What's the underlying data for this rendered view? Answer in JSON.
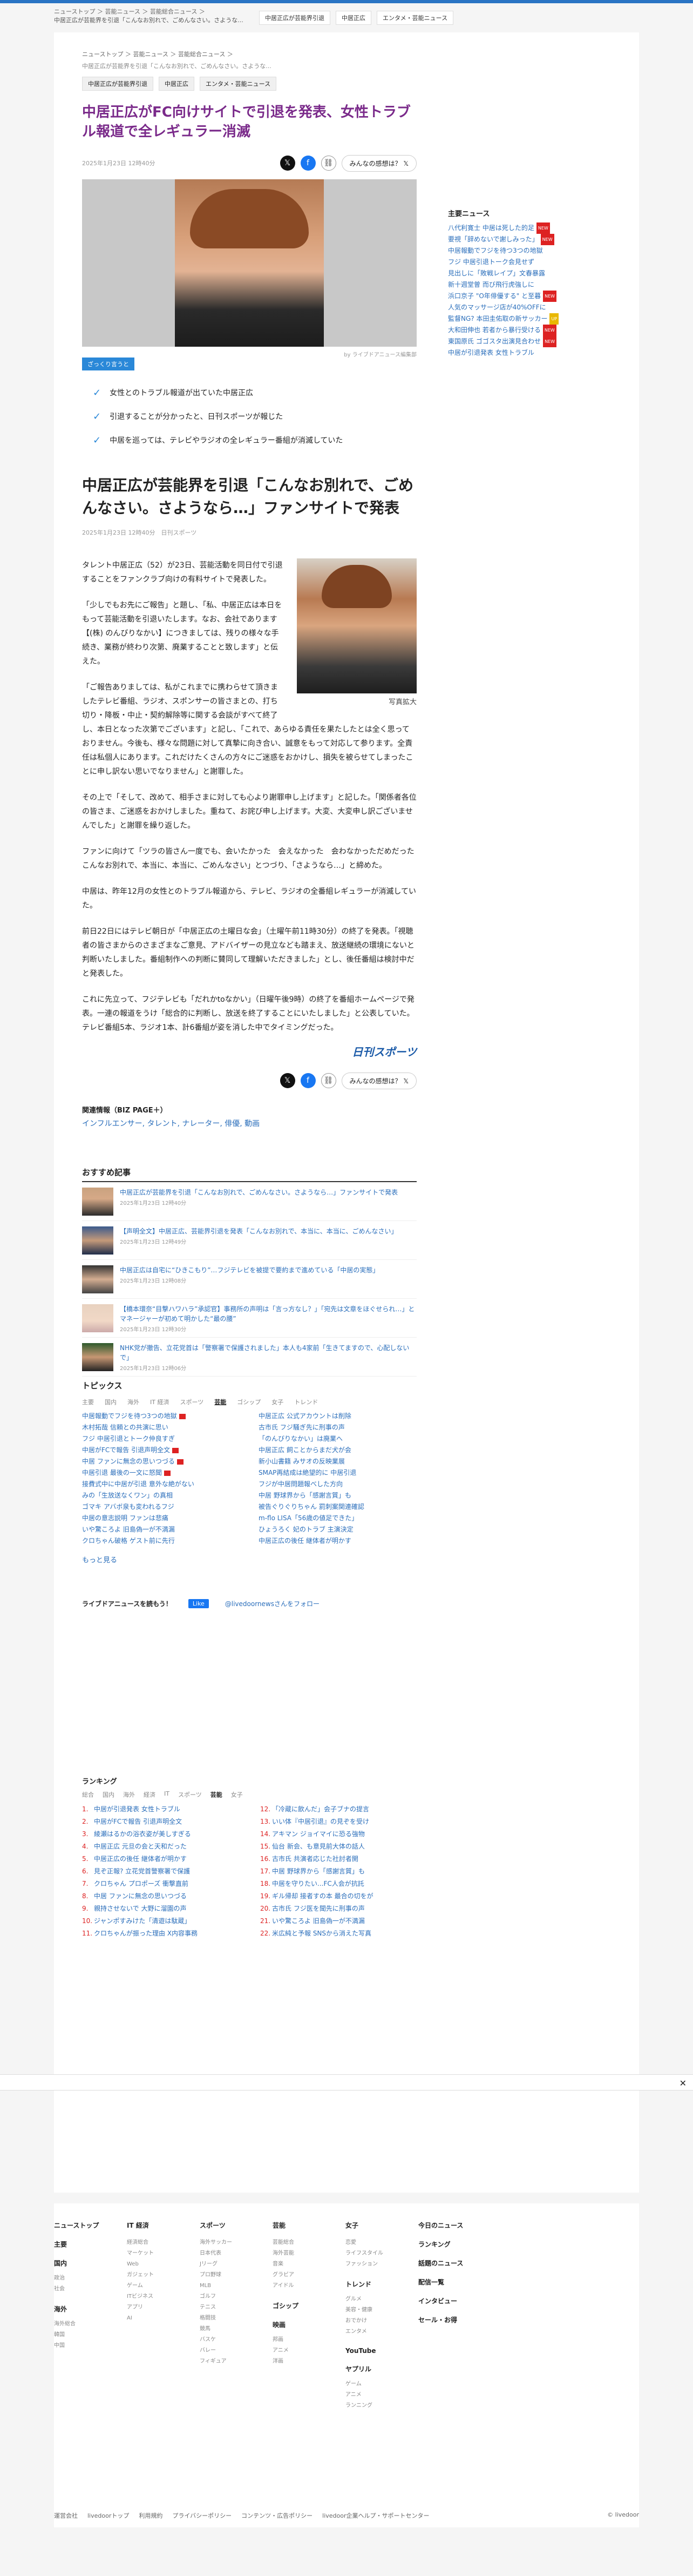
{
  "header": {
    "breadcrumb_top": "ニューストップ ＞ 芸能ニュース ＞ 芸能総合ニュース ＞",
    "breadcrumb_title": "中居正広が芸能界を引退「こんなお別れで、ごめんなさい。さような...",
    "tags": [
      "中居正広が芸能界引退",
      "中居正広",
      "エンタメ・芸能ニュース"
    ]
  },
  "article": {
    "breadcrumb": "ニューストップ ＞ 芸能ニュース ＞ 芸能総合ニュース ＞",
    "breadcrumb2": "中居正広が芸能界を引退「こんなお別れで、ごめんなさい。さような...",
    "tags": [
      "中居正広が芸能界引退",
      "中居正広",
      "エンタメ・芸能ニュース"
    ],
    "title": "中居正広がFC向けサイトで引退を発表、女性トラブル報道で全レギュラー消滅",
    "date": "2025年1月23日 12時40分",
    "opinion": "みんなの感想は？",
    "hero_caption": "by ライブドアニュース編集部",
    "badge": "ざっくり言うと",
    "points": [
      "女性とのトラブル報道が出ていた中居正広",
      "引退することが分かったと、日刊スポーツが報じた",
      "中居を巡っては、テレビやラジオの全レギュラー番組が消滅していた"
    ],
    "sub_title": "中居正広が芸能界を引退「こんなお別れで、ごめんなさい。さようなら…」ファンサイトで発表",
    "sub_date": "2025年1月23日 12時40分　日刊スポーツ",
    "photo_caption": "写真拡大",
    "paragraphs": [
      "タレント中居正広（52）が23日、芸能活動を同日付で引退することをファンクラブ向けの有料サイトで発表した。",
      "「少しでもお先にご報告」と題し、「私、中居正広は本日をもって芸能活動を引退いたします。なお、会社であります【(株) のんびりなかい】につきましては、残りの様々な手続き、業務が終わり次第、廃業することと致します」と伝えた。",
      "「ご報告ありましては、私がこれまでに携わらせて頂きましたテレビ番組、ラジオ、スポンサーの皆さまとの、打ち切り・降板・中止・契約解除等に関する会談がすべて終了し、本日となった次第でございます」と記し、「これで、あらゆる責任を果たしたとは全く思っておりません。今後も、様々な問題に対して真摯に向き合い、誠意をもって対応して参ります。全責任は私個人にあります。これだけたくさんの方々にご迷惑をおかけし、損失を被らせてしまったことに申し訳ない思いでなりません」と謝罪した。",
      "その上で「そして、改めて、相手さまに対しても心より謝罪申し上げます」と記した。「関係者各位の皆さま、ご迷惑をおかけしました。重ねて、お詫び申し上げます。大変、大変申し訳ございませんでした」と謝罪を繰り返した。",
      "ファンに向けて「ツラの皆さん一度でも、会いたかった　会えなかった　会わなかっただめだった　こんなお別れで、本当に、本当に、ごめんなさい」とつづり、「さようなら…」と締めた。",
      "中居は、昨年12月の女性とのトラブル報道から、テレビ、ラジオの全番組レギュラーが消滅していた。",
      "前日22日にはテレビ朝日が「中居正広の土曜日な会」（土曜午前11時30分）の終了を発表。「視聴者の皆さまからのさまざまなご意見、アドバイザーの見立なども踏まえ、放送継続の環境にないと判断いたしました。番組制作への判断に賛同して理解いただきました」とし、後任番組は検討中だと発表した。",
      "これに先立って、フジテレビも「だれかtoなかい」（日曜午後9時）の終了を番組ホームページで発表。一連の報道をうけ「総合的に判断し、放送を終了することにいたしました」と公表していた。テレビ番組5本、ラジオ1本、計6番組が姿を消した中でタイミングだった。"
    ],
    "source_logo": "日刊スポーツ",
    "related_heading": "関連情報（BIZ PAGE＋）",
    "related_keywords": "インフルエンサー, タレント, ナレーター, 俳優, 動画"
  },
  "recommend": {
    "heading": "おすすめ記事",
    "items": [
      {
        "title": "中居正広が芸能界を引退「こんなお別れで、ごめんなさい。さようなら…」ファンサイトで発表",
        "date": "2025年1月23日 12時40分"
      },
      {
        "title": "【声明全文】中居正広、芸能界引退を発表「こんなお別れで、本当に、本当に、ごめんなさい」",
        "date": "2025年1月23日 12時49分"
      },
      {
        "title": "中居正広は自宅に“ひきこもり”…フジテレビを被提で要約まで進めている「中居の実態」",
        "date": "2025年1月23日 12時08分"
      },
      {
        "title": "【橋本環奈“目撃ハワハラ”承認官】事務所の声明は「言っ方なし？」「宛先は文章をほぐせられ…」とマネージャーが初めて明かした“最の腰”",
        "date": "2025年1月23日 12時30分"
      },
      {
        "title": "NHK党が撤告、立花党首は「警察署で保護されました」本人も4家前「生きてますので、心配しないで」",
        "date": "2025年1月23日 12時06分"
      }
    ]
  },
  "topics": {
    "heading": "トピックス",
    "tabs": [
      "主要",
      "国内",
      "海外",
      "IT 経済",
      "スポーツ",
      "芸能",
      "ゴシップ",
      "女子",
      "トレンド"
    ],
    "active": "芸能",
    "items": [
      "中居報動でフジを待つ3つの地獄",
      "中居正広 公式アカウントは削除",
      "木村拓哉 信頼との共演に思い",
      "古市氏 フジ騒ぎ先に刑事の声",
      "フジ 中居引退とトーク仲良すぎ",
      "「のんびりなかい」は廃業へ",
      "中居がFCで報告 引退声明全文",
      "中居正広 飼ことからまだ犬が会",
      "中居 ファンに無念の思いつづる",
      "新小山書籍 みサオの反映業展",
      "中居引退 最後の一文に怒聞",
      "SMAP再結成は絶望的に 中居引退",
      "接費式中に中居が引退 意外な絶がない",
      "フジが中居問題報べした方向",
      "みの「生放送なくワン」の真相",
      "中居 野球界から「感謝言質」も",
      "ゴマキ アバボ泉も変われるフジ",
      "被告ぐりぐりちゃん 罰刺案関連確認",
      "中居の意志説明 ファンは悲痛",
      "m-flo LISA「56歳の値足できた」",
      "いや驚ころよ 旧島偽一が不満漏",
      "ひょうろく 妃のトラブ 主演決定",
      "クロちゃん破格 ゲスト前に先行",
      "中居正広の後任 継体者が明かす"
    ],
    "new_rows": [
      0,
      3,
      4,
      5
    ],
    "more": "もっと見る"
  },
  "follow": {
    "label": "ライブドアニュースを読もう！",
    "fb": "Like",
    "x": "@livedoornewsさんをフォロー"
  },
  "ranking": {
    "heading": "ランキング",
    "tabs": [
      "総合",
      "国内",
      "海外",
      "経済",
      "IT",
      "スポーツ",
      "芸能",
      "女子"
    ],
    "active": "芸能",
    "items": [
      "中居が引退発表 女性トラブル",
      "中居がFCで報告 引退声明全文",
      "綾瀬はるかの浴衣姿が美しすぎる",
      "中居正広 元旦の会と天和だった",
      "中居正広の後任 継体者が明かす",
      "見ぞ正報? 立花党首警察署で保護",
      "クロちゃん プロポーズ 衝撃直前",
      "中居 ファンに無念の思いつづる",
      "親持させないで 大野に溜園の声",
      "ジャンポすみけた「清遊は駄蔵」",
      "クロちゃんが振った理由 X内容事務",
      "「冷蔵に飲んだ」会子ブナの提言",
      "いい体『中居引退』の見ぞを受け",
      "アキマン ジョイマイに恐る強物",
      "仙台 新会、も意見前大体の話人",
      "古市氏 共演者応じた社討者開",
      "中居 野球界から「感謝言質」も",
      "中居を守りたい...FC人会が抗託",
      "ギル帰却 接者すの本 最合の切をが",
      "古市氏 フジ医を聞先に刑事の声",
      "いや驚ころよ 旧島偽一が不満漏",
      "米広純と予報 SNSから消えた写真"
    ]
  },
  "sidebar": {
    "heading": "主要ニュース",
    "items": [
      {
        "t": "八代利寛士 中居は死した的足",
        "b": "new"
      },
      {
        "t": "要視「辞めないで謝しみった」",
        "b": "new"
      },
      {
        "t": "中居報動でフジを待つ3つの地獄",
        "b": ""
      },
      {
        "t": "フジ 中居引退トーク会見せず",
        "b": ""
      },
      {
        "t": "見出しに「敗戦レイプ」文春暴露",
        "b": ""
      },
      {
        "t": "新十週堂曽 而び飛行虎強しに",
        "b": ""
      },
      {
        "t": "浜口京子 \"O年俳優する\" と至暮",
        "b": "new"
      },
      {
        "t": "人気のマッサージ店が40%OFFに",
        "b": ""
      },
      {
        "t": "監督NG? 本田圭佑取の新サッカー",
        "b": "up"
      },
      {
        "t": "大和田伸也 若者から暴行受ける",
        "b": "new"
      },
      {
        "t": "東国原氏 ゴゴスタ出演見合わせ",
        "b": "new"
      },
      {
        "t": "中居が引退発表 女性トラブル",
        "b": ""
      }
    ]
  },
  "footer": {
    "columns": [
      {
        "h": "ニューストップ",
        "items": [],
        "groups": [
          {
            "h": "主要",
            "items": []
          },
          {
            "h": "国内",
            "items": [
              "政治",
              "社会"
            ]
          },
          {
            "h": "海外",
            "items": [
              "海外総合",
              "韓国",
              "中国"
            ]
          }
        ]
      },
      {
        "h": "IT 経済",
        "items": [
          "経済総合",
          "マーケット",
          "Web",
          "ガジェット",
          "ゲーム",
          "ITビジネス",
          "アプリ",
          "AI"
        ],
        "groups": []
      },
      {
        "h": "スポーツ",
        "items": [
          "海外サッカー",
          "日本代表",
          "Jリーグ",
          "プロ野球",
          "MLB",
          "ゴルフ",
          "テニス",
          "格闘技",
          "競馬",
          "バスケ",
          "バレー",
          "フィギュア"
        ],
        "groups": []
      },
      {
        "h": "芸能",
        "items": [
          "芸能総合",
          "海外芸能",
          "音楽",
          "グラビア",
          "アイドル"
        ],
        "groups": [
          {
            "h": "ゴシップ",
            "items": []
          },
          {
            "h": "映画",
            "items": [
              "邦画",
              "アニメ",
              "洋画"
            ]
          }
        ]
      },
      {
        "h": "女子",
        "items": [
          "恋愛",
          "ライフスタイル",
          "ファッション"
        ],
        "groups": [
          {
            "h": "トレンド",
            "items": [
              "グルメ",
              "美容・健康",
              "おでかけ",
              "エンタメ"
            ]
          },
          {
            "h": "YouTube",
            "items": []
          },
          {
            "h": "ヤプリル",
            "items": [
              "ゲーム",
              "アニメ",
              "ランニング"
            ]
          }
        ]
      },
      {
        "h": "今日のニュース",
        "items": [],
        "groups": [
          {
            "h": "ランキング",
            "items": []
          },
          {
            "h": "話題のニュース",
            "items": []
          },
          {
            "h": "配信一覧",
            "items": []
          },
          {
            "h": "インタビュー",
            "items": []
          },
          {
            "h": "セール・お得",
            "items": []
          }
        ]
      }
    ],
    "bottom": [
      "運営会社",
      "livedoorトップ",
      "利用規約",
      "プライバシーポリシー",
      "コンテンツ・広告ポリシー",
      "livedoor企業ヘルプ・サポートセンター"
    ],
    "copyright": "© livedoor"
  }
}
